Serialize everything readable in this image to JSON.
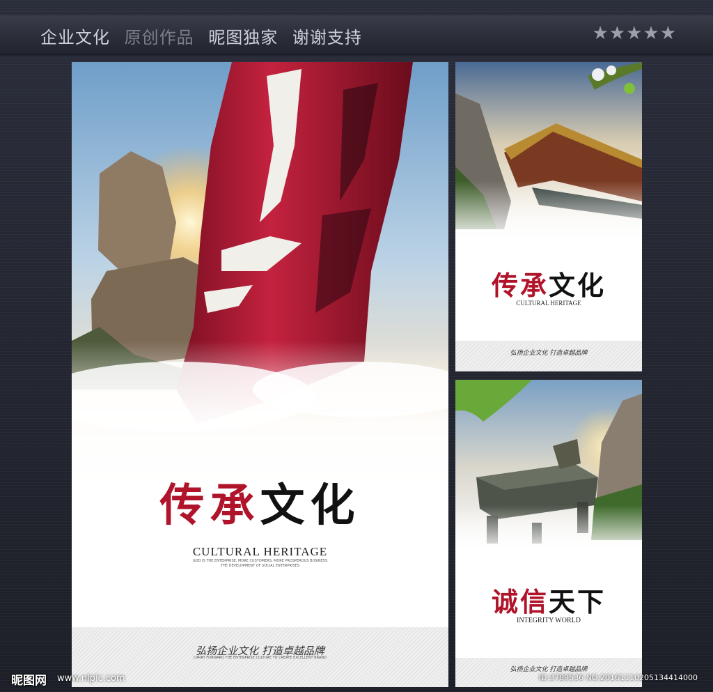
{
  "header": {
    "segments": [
      "企业文化",
      "原创作品",
      "昵图独家",
      "谢谢支持"
    ],
    "rating_stars": "★★★★★"
  },
  "poster_main": {
    "title_part1": "传承",
    "title_part2": "文化",
    "subtitle_en": "CULTURAL HERITAGE",
    "tagline_line1": "GOD IS THE ENTERPRISE, MORE CUSTOMERS, MORE PROSPEROUS BUSINESS",
    "tagline_line2": "THE DEVELOPMENT OF SOCIAL ENTERPRISES",
    "slogan": "弘扬企业文化  打造卓越品牌",
    "slogan_en": "CARRY FORWARD THE ENTERPRISE CULTURE TO CREATE EXCELLENT BRAND"
  },
  "poster_top_right": {
    "title_part1": "传承",
    "title_part2": "文化",
    "subtitle_en": "CULTURAL HERITAGE",
    "slogan": "弘扬企业文化  打造卓越品牌"
  },
  "poster_bottom_right": {
    "title_part1": "诚信",
    "title_part2": "天下",
    "subtitle_en": "INTEGRITY WORLD",
    "slogan": "弘扬企业文化  打造卓越品牌"
  },
  "watermark": {
    "logo": "昵图网",
    "url": "www.nipic.com",
    "id_text": "ID:3789536 NO:20161110205134414000"
  },
  "colors": {
    "background": "#25283a",
    "title_red": "#b0142a",
    "title_black": "#111111"
  }
}
